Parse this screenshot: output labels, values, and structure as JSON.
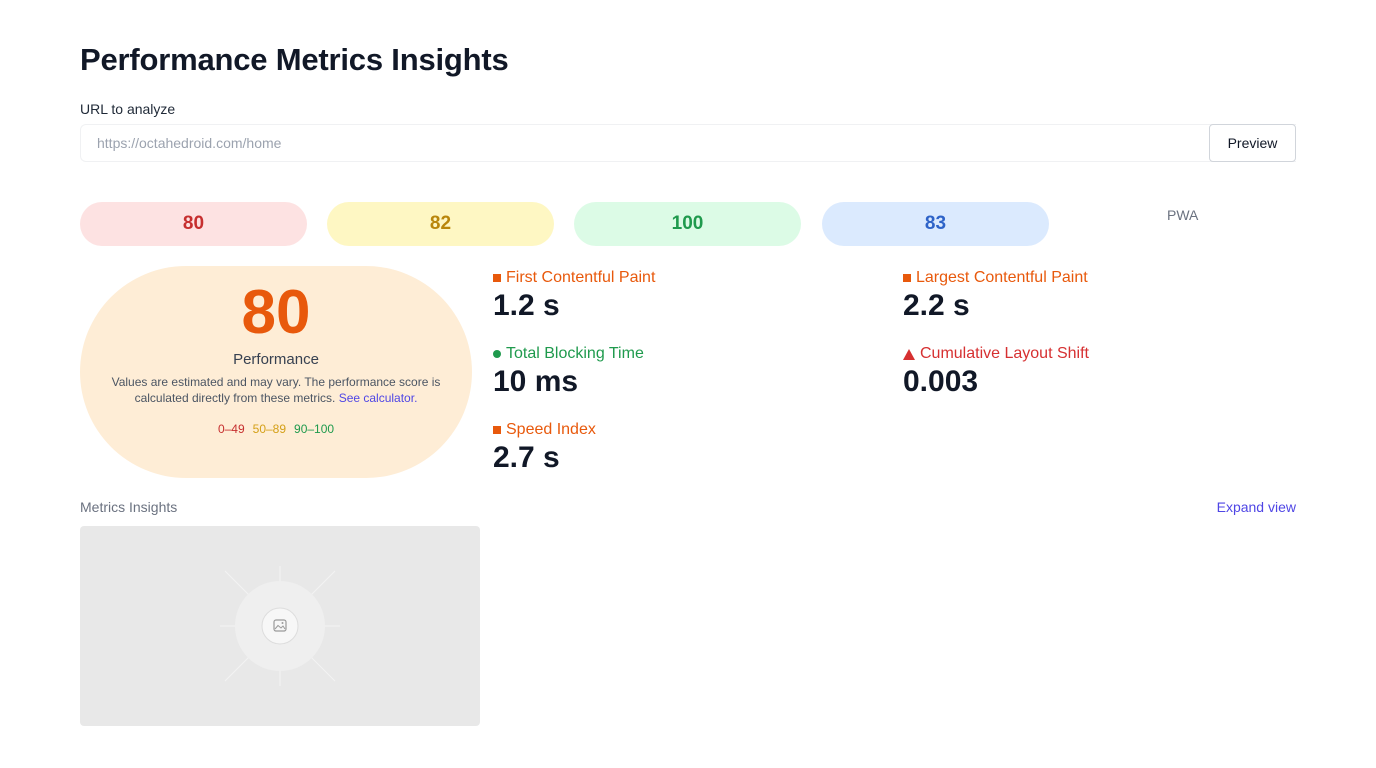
{
  "page": {
    "title": "Performance Metrics Insights"
  },
  "url_form": {
    "label": "URL to analyze",
    "placeholder": "https://octahedroid.com/home",
    "value": "",
    "button_label": "Preview"
  },
  "category_scores": [
    {
      "value": "80",
      "color": "#c62f2f"
    },
    {
      "value": "82",
      "color": "#b9860b"
    },
    {
      "value": "100",
      "color": "#1f9a4d"
    },
    {
      "value": "83",
      "color": "#2e63c8"
    }
  ],
  "pwa_label": "PWA",
  "gauge": {
    "score": "80",
    "label": "Performance",
    "description": "Values are estimated and may vary. The performance score is calculated directly from these metrics.",
    "link_text": "See calculator.",
    "legend": [
      "0–49",
      "50–89",
      "90–100"
    ]
  },
  "metrics": [
    {
      "name": "First Contentful Paint",
      "value": "1.2 s",
      "status_icon": "orange-square-icon"
    },
    {
      "name": "Largest Contentful Paint",
      "value": "2.2 s",
      "status_icon": "orange-square-icon"
    },
    {
      "name": "Total Blocking Time",
      "value": "10 ms",
      "status_icon": "green-circle-icon"
    },
    {
      "name": "Cumulative Layout Shift",
      "value": "0.003",
      "status_icon": "red-triangle-icon"
    },
    {
      "name": "Speed Index",
      "value": "2.7 s",
      "status_icon": "orange-square-icon"
    }
  ],
  "insights": {
    "label": "Metrics Insights",
    "expand_label": "Expand view",
    "image_icon": "image-placeholder-icon"
  }
}
